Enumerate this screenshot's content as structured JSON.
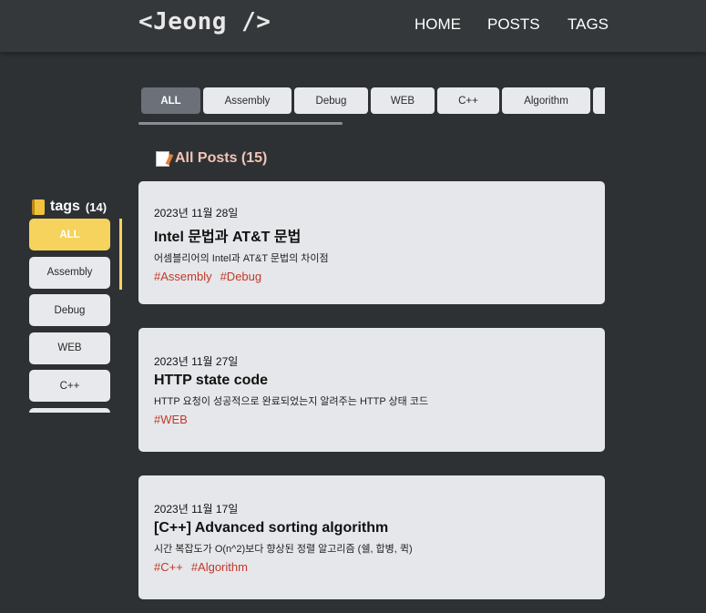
{
  "header": {
    "logo": "<Jeong />",
    "nav": [
      "HOME",
      "POSTS",
      "TAGS"
    ]
  },
  "tagbar": {
    "items": [
      "ALL",
      "Assembly",
      "Debug",
      "WEB",
      "C++",
      "Algorithm",
      ""
    ],
    "active": "ALL"
  },
  "posts": {
    "heading_icon": "memo-icon",
    "heading": "All Posts (15)"
  },
  "sidebar": {
    "icon": "notebook-icon",
    "title": "tags",
    "count": "(14)",
    "items": [
      "ALL",
      "Assembly",
      "Debug",
      "WEB",
      "C++"
    ],
    "active": "ALL"
  },
  "cards": [
    {
      "date": "2023년 11월 28일",
      "title": "Intel 문법과 AT&T 문법",
      "desc": "어셈블리어의 Intel과 AT&T 문법의 차이점",
      "tags": [
        "#Assembly",
        "#Debug"
      ]
    },
    {
      "date": "2023년 11월 27일",
      "title": "HTTP state code",
      "desc": "HTTP 요청이 성공적으로 완료되었는지 알려주는 HTTP 상태 코드",
      "tags": [
        "#WEB"
      ]
    },
    {
      "date": "2023년 11월 17일",
      "title": "[C++] Advanced sorting algorithm",
      "desc": "시간 복잡도가 O(n^2)보다 향상된 정렬 알고리즘 (쉘, 합병, 퀵)",
      "tags": [
        "#C++",
        "#Algorithm"
      ]
    }
  ],
  "colors": {
    "background": "#2e3134",
    "header": "#34383b",
    "accent_yellow": "#f5d35c",
    "active_tag": "#6b7079",
    "tag_text": "#c0392b",
    "heading_salmon": "#f2c5b7"
  }
}
